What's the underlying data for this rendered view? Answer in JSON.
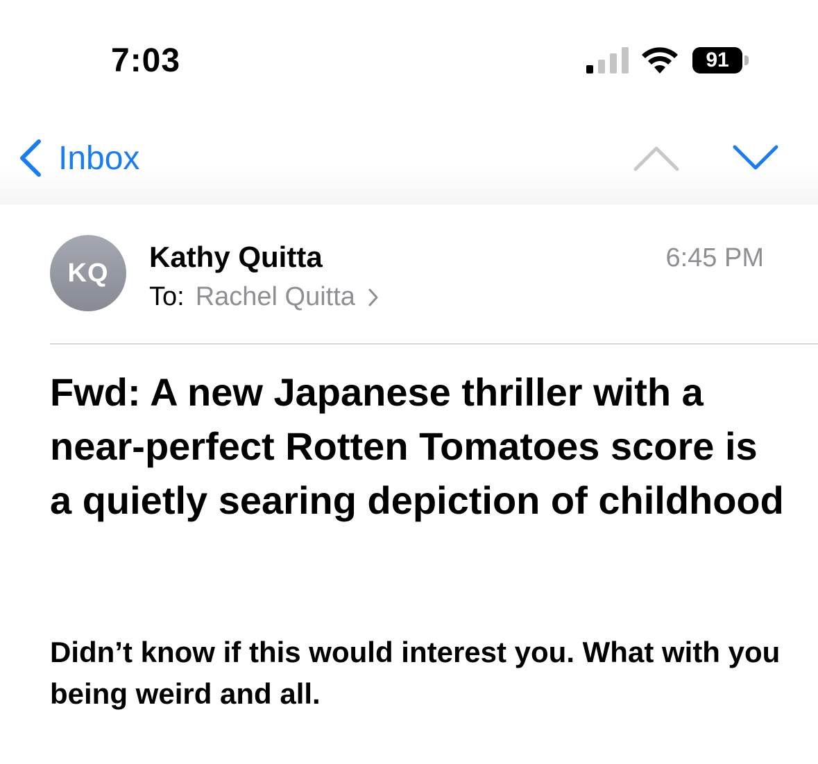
{
  "status_bar": {
    "time": "7:03",
    "battery_level": "91",
    "signal_icon": "cellular-signal-icon",
    "wifi_icon": "wifi-icon"
  },
  "nav": {
    "back_label": "Inbox",
    "back_icon": "chevron-left-icon",
    "previous_icon": "chevron-up-icon",
    "next_icon": "chevron-down-icon"
  },
  "message": {
    "sender_initials": "KQ",
    "sender_name": "Kathy Quitta",
    "to_label": "To:",
    "recipient": "Rachel Quitta",
    "time": "6:45 PM",
    "subject": "Fwd: A new Japanese thriller with a near-perfect Rotten Tomatoes score is a quietly searing depiction of childhood",
    "body": "Didn’t know if this would interest you. What with you being weird and all."
  },
  "colors": {
    "accent": "#1a7cf5",
    "secondary_text": "#8e8e93",
    "avatar": "#8f929b"
  }
}
